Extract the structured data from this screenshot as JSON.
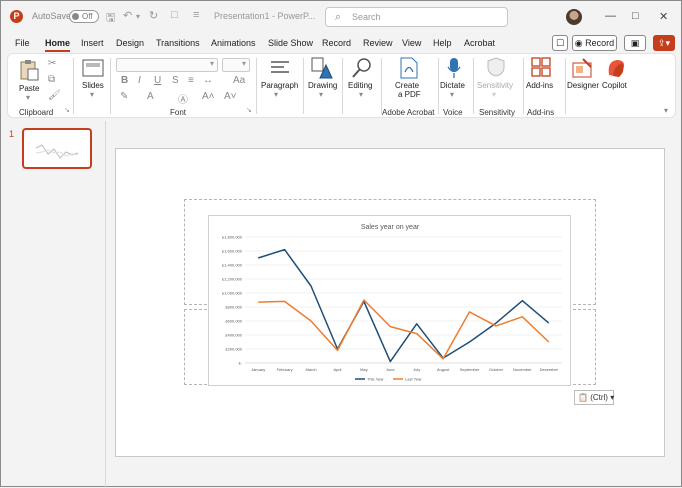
{
  "titlebar": {
    "app_logo": "P",
    "autosave_label": "AutoSave",
    "autosave_state": "Off",
    "doc_title": "Presentation1 - PowerP...",
    "search_placeholder": "Search"
  },
  "menu": {
    "tabs": [
      "File",
      "Home",
      "Insert",
      "Design",
      "Transitions",
      "Animations",
      "Slide Show",
      "Record",
      "Review",
      "View",
      "Help",
      "Acrobat"
    ],
    "active": "Home",
    "record_button": "Record"
  },
  "ribbon": {
    "clipboard": {
      "group": "Clipboard",
      "paste": "Paste"
    },
    "slides": {
      "label": "Slides"
    },
    "font": {
      "group": "Font",
      "bold": "B",
      "italic": "I",
      "underline": "U",
      "strike": "S"
    },
    "paragraph": {
      "label": "Paragraph"
    },
    "drawing": {
      "label": "Drawing"
    },
    "editing": {
      "label": "Editing"
    },
    "acrobat": {
      "label_line1": "Create",
      "label_line2": "a PDF",
      "group": "Adobe Acrobat"
    },
    "voice": {
      "label": "Dictate",
      "group": "Voice"
    },
    "sensitivity": {
      "label": "Sensitivity",
      "group": "Sensitivity"
    },
    "addins": {
      "label": "Add-ins",
      "group": "Add-ins"
    },
    "designer": {
      "label": "Designer"
    },
    "copilot": {
      "label": "Copilot"
    }
  },
  "slides_pane": {
    "current": "1"
  },
  "paste_options": {
    "label": "(Ctrl)"
  },
  "chart_data": {
    "type": "line",
    "title": "Sales year on year",
    "categories": [
      "January",
      "February",
      "March",
      "April",
      "May",
      "June",
      "July",
      "August",
      "September",
      "October",
      "November",
      "December"
    ],
    "yticks": [
      "£-",
      "£200,000",
      "£400,000",
      "£600,000",
      "£800,000",
      "£1,000,000",
      "£1,200,000",
      "£1,400,000",
      "£1,600,000",
      "£1,800,000"
    ],
    "ylim": [
      0,
      1800000
    ],
    "series": [
      {
        "name": "This Year",
        "color": "#1f4e79",
        "values": [
          1500000,
          1620000,
          1100000,
          200000,
          880000,
          20000,
          560000,
          70000,
          300000,
          570000,
          890000,
          570000
        ]
      },
      {
        "name": "Last Year",
        "color": "#ed7d31",
        "values": [
          870000,
          880000,
          600000,
          180000,
          900000,
          520000,
          420000,
          60000,
          730000,
          530000,
          660000,
          300000
        ]
      }
    ],
    "legend": "bottom",
    "grid": true
  }
}
